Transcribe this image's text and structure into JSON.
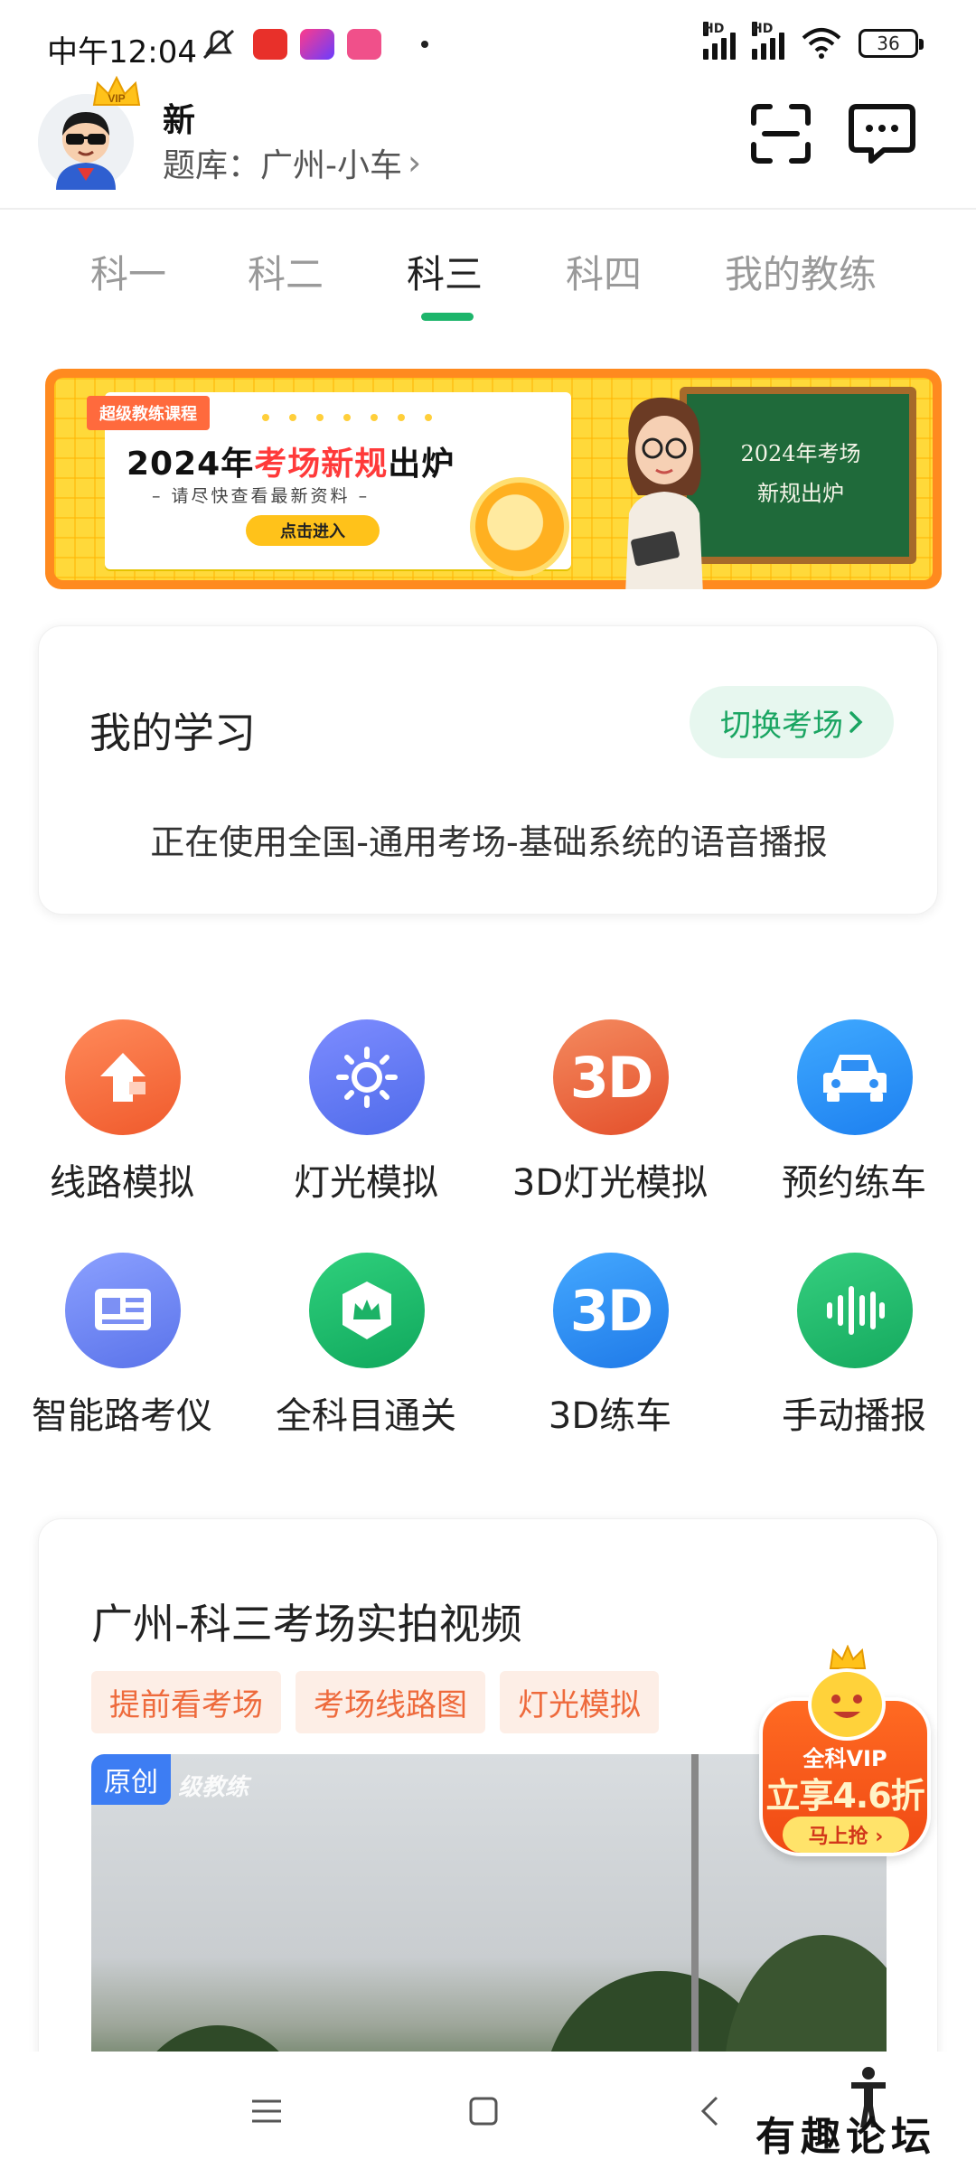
{
  "status_bar": {
    "time": "中午12:04",
    "battery": "36",
    "signal1_label": "HD",
    "signal2_label": "HD"
  },
  "header": {
    "user_name": "新",
    "bank_label": "题库：广州-小车",
    "bank_chevron": "›"
  },
  "tabs": [
    {
      "label": "科一",
      "active": false
    },
    {
      "label": "科二",
      "active": false
    },
    {
      "label": "科三",
      "active": true
    },
    {
      "label": "科四",
      "active": false
    },
    {
      "label": "我的教练",
      "active": false
    }
  ],
  "banner": {
    "tag": "超级教练课程",
    "title_prefix": "2024年",
    "title_highlight": "考场新规",
    "title_suffix": "出炉",
    "subtitle": "– 请尽快查看最新资料 –",
    "button": "点击进入",
    "chalk_line1": "2024年考场",
    "chalk_line2": "新规出炉"
  },
  "study": {
    "title": "我的学习",
    "switch_label": "切换考场",
    "description": "正在使用全国-通用考场-基础系统的语音播报"
  },
  "features": [
    {
      "label": "线路模拟",
      "icon": "arrow-up-icon"
    },
    {
      "label": "灯光模拟",
      "icon": "sun-icon"
    },
    {
      "label": "3D灯光模拟",
      "icon": "3d-icon"
    },
    {
      "label": "预约练车",
      "icon": "car-icon"
    },
    {
      "label": "智能路考仪",
      "icon": "device-icon"
    },
    {
      "label": "全科目通关",
      "icon": "crown-badge-icon"
    },
    {
      "label": "3D练车",
      "icon": "3d-icon"
    },
    {
      "label": "手动播报",
      "icon": "soundwave-icon"
    }
  ],
  "feature_glyphs": {
    "three_d": "3D"
  },
  "video": {
    "title": "广州-科三考场实拍视频",
    "chips": [
      "提前看考场",
      "考场线路图",
      "灯光模拟"
    ],
    "badge": "原创",
    "watermark": "级教练"
  },
  "vip_float": {
    "line1": "全科VIP",
    "line2": "立享4.6折",
    "button": "马上抢 ›"
  },
  "footer_watermark": "有趣论坛",
  "colors": {
    "accent_green": "#1db56b",
    "chip_text": "#ee6a3c",
    "vip_orange": "#f04a14"
  }
}
